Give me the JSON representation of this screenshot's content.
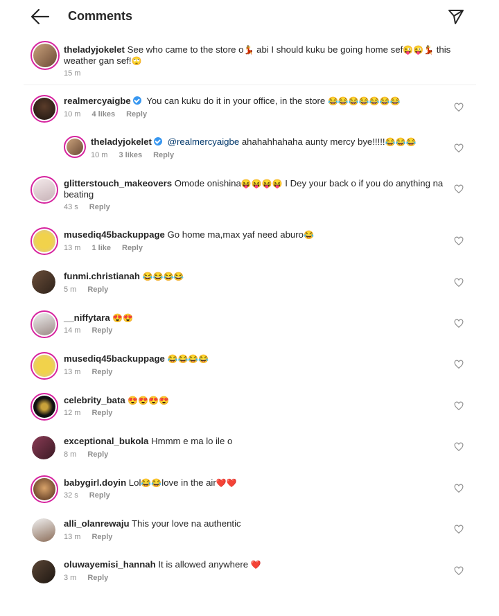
{
  "header": {
    "title": "Comments"
  },
  "post": {
    "username": "theladyjokelet",
    "text_a": "See who came to the store o",
    "emoji_a": "💃",
    "text_b": " abi I should kuku be going home sef",
    "emoji_b": "😜😜💃",
    "text_c": " this",
    "text_d": "weather gan sef!",
    "emoji_d": "🙄",
    "time": "15 m"
  },
  "comments": [
    {
      "username": "realmercyaigbe",
      "text": "You can kuku do it in your office, in the store ",
      "emoji": "😂😂😂😂😂😂😂",
      "time": "10 m",
      "likes": "4 likes",
      "reply": "Reply"
    },
    {
      "username": "theladyjokelet",
      "mention": "@realmercyaigbe",
      "text": " ahahahhahaha aunty mercy bye!!!!!",
      "emoji": "😂😂😂",
      "time": "10 m",
      "likes": "3 likes",
      "reply": "Reply"
    },
    {
      "username": "glitterstouch_makeovers",
      "text": "Omode onishina",
      "emoji": "😝😝😝😝",
      "text2": " I Dey your back o if you do anything na",
      "text3": "beating",
      "time": "43 s",
      "reply": "Reply"
    },
    {
      "username": "musediq45backuppage",
      "text": "Go home ma,max yaf need aburo",
      "emoji": "😂",
      "time": "13 m",
      "likes": "1 like",
      "reply": "Reply"
    },
    {
      "username": "funmi.christianah",
      "text": "",
      "emoji": "😂😂😂😂",
      "time": "5 m",
      "reply": "Reply"
    },
    {
      "username": "__niffytara",
      "text": "",
      "emoji": "😍😍",
      "time": "14 m",
      "reply": "Reply"
    },
    {
      "username": "musediq45backuppage",
      "text": "",
      "emoji": "😂😂😂😂",
      "time": "13 m",
      "reply": "Reply"
    },
    {
      "username": "celebrity_bata",
      "text": "",
      "emoji": "😍😍😍😍",
      "time": "12 m",
      "reply": "Reply"
    },
    {
      "username": "exceptional_bukola",
      "text": "Hmmm e ma lo ile o",
      "emoji": "",
      "time": "8 m",
      "reply": "Reply"
    },
    {
      "username": "babygirl.doyin",
      "text": "Lol",
      "emoji": "😂😂",
      "text2": "love in the air",
      "emoji2": "❤️❤️",
      "time": "32 s",
      "reply": "Reply"
    },
    {
      "username": "alli_olanrewaju",
      "text": "This your love na authentic",
      "emoji": "",
      "time": "13 m",
      "reply": "Reply"
    },
    {
      "username": "oluwayemisi_hannah",
      "text": "It is allowed anywhere ",
      "emoji": "❤️",
      "time": "3 m",
      "reply": "Reply"
    }
  ],
  "colors": {
    "accent_ring": "#d6249f",
    "verified": "#3897f0",
    "meta": "#8e8e8e",
    "text": "#262626"
  },
  "icons": {
    "back": "arrow-left-icon",
    "send": "paper-plane-icon",
    "like": "heart-outline-icon",
    "verified": "verified-badge-icon"
  }
}
